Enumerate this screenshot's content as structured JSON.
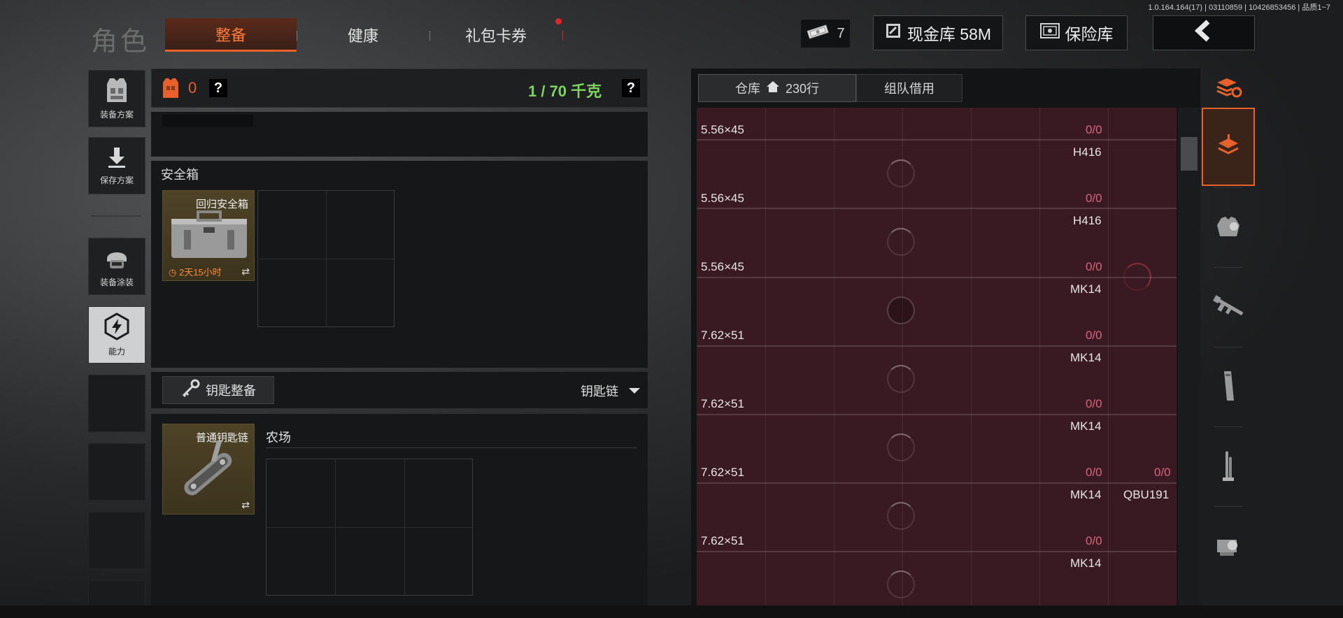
{
  "version": "1.0.164.164(17) | 03110859 | 10426853456 | 品质1~7",
  "title": "角色",
  "tabs": [
    {
      "label": "整备",
      "active": true
    },
    {
      "label": "健康",
      "active": false
    },
    {
      "label": "礼包卡券",
      "active": false,
      "badge": true
    }
  ],
  "topbar": {
    "cash_icon": "banknote-icon",
    "cash_count": "7",
    "cash_vault": "现金库 58M",
    "safe_vault": "保险库",
    "back_icon": "back-arrow-icon"
  },
  "sidebar": [
    {
      "label": "装备方案",
      "icon": "vest-icon"
    },
    {
      "label": "保存方案",
      "icon": "download-icon"
    },
    {
      "label": "装备涂装",
      "icon": "helmet-icon"
    },
    {
      "label": "能力",
      "icon": "ability-icon",
      "selected": true
    }
  ],
  "equipment": {
    "armor_count": "0",
    "weight": "1 / 70 千克",
    "help": "?"
  },
  "safebox": {
    "section_label": "安全箱",
    "item_name": "回归安全箱",
    "timer": "2天15小时"
  },
  "keys": {
    "button_label": "钥匙整备",
    "dropdown_label": "钥匙链",
    "item_name": "普通钥匙链",
    "map_label": "农场"
  },
  "warehouse": {
    "tab_storage": "仓库",
    "rows_label": "230行",
    "tab_team": "组队借用",
    "rows": [
      {
        "weapon": "",
        "caliber": "5.56×45",
        "count": "0/0"
      },
      {
        "weapon": "H416",
        "caliber": "5.56×45",
        "count": "0/0"
      },
      {
        "weapon": "H416",
        "caliber": "5.56×45",
        "count": "0/0"
      },
      {
        "weapon": "MK14",
        "caliber": "7.62×51",
        "count": "0/0"
      },
      {
        "weapon": "MK14",
        "caliber": "7.62×51",
        "count": "0/0"
      },
      {
        "weapon": "MK14",
        "caliber": "7.62×51",
        "count": "0/0",
        "extra_count": "0/0"
      },
      {
        "weapon": "MK14",
        "extra_weapon": "QBU191",
        "caliber": "7.62×51",
        "count": "0/0"
      },
      {
        "weapon": "MK14",
        "caliber": "",
        "count": ""
      }
    ]
  },
  "categories": [
    {
      "icon": "stack-refresh-icon"
    },
    {
      "icon": "layers-icon",
      "active": true
    },
    {
      "icon": "armor-icon"
    },
    {
      "icon": "rifle-icon"
    },
    {
      "icon": "magazine-icon"
    },
    {
      "icon": "ammo-icon"
    },
    {
      "icon": "scope-icon"
    }
  ],
  "colors": {
    "accent": "#e8602c",
    "weight_green": "#7fd35f",
    "count_red": "#d8657f",
    "row_bg": "#3a1a22"
  }
}
